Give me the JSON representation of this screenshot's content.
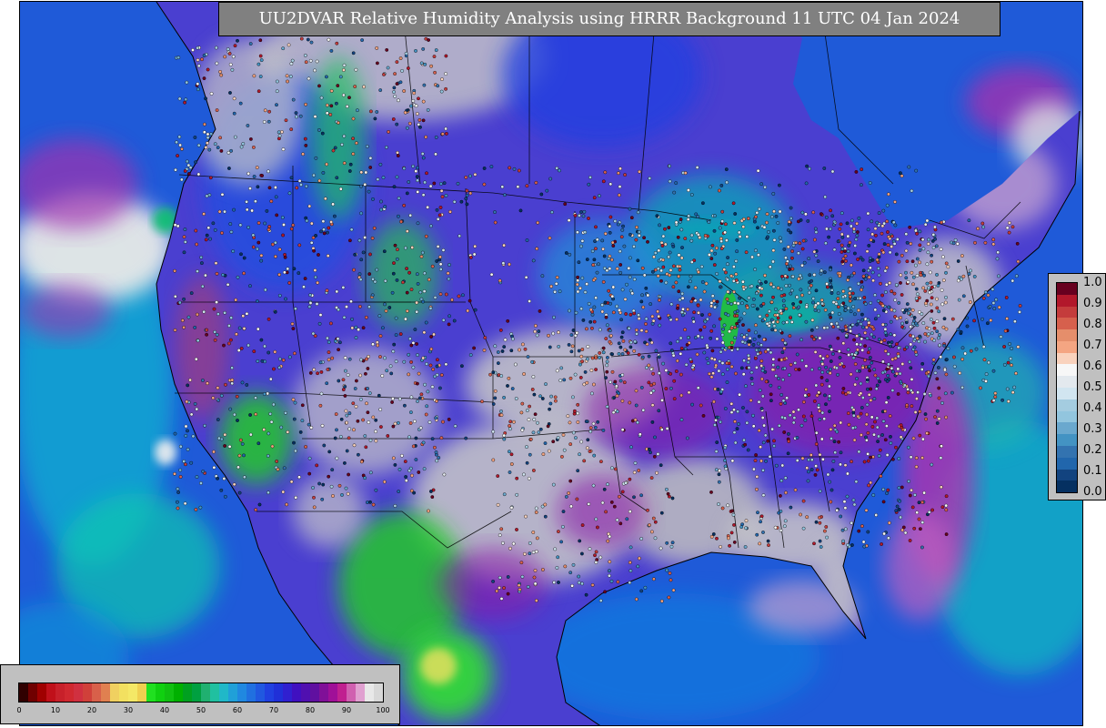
{
  "title": "UU2DVAR Relative Humidity Analysis using HRRR Background 11 UTC 04 Jan 2024",
  "colors": {
    "ocean_base": "#1f5ad8",
    "land_base": "#4a3fd0",
    "dry_gray": "#c8c8c8",
    "humid_purple": "#8a1aa8",
    "green": "#20d020",
    "teal": "#10a8b0",
    "lake_green": "#20c040"
  },
  "obs_scale": {
    "labels": [
      "1.0",
      "0.9",
      "0.8",
      "0.7",
      "0.6",
      "0.5",
      "0.4",
      "0.3",
      "0.2",
      "0.1",
      "0.0"
    ],
    "colors": [
      "#67001f",
      "#b2182b",
      "#c43c3c",
      "#d6604d",
      "#e58e6b",
      "#f4a582",
      "#f9d2bd",
      "#f7f7f7",
      "#e3e9ee",
      "#d1e5f0",
      "#a4cce0",
      "#92c5de",
      "#6aa8ce",
      "#4393c3",
      "#3373b0",
      "#2166ac",
      "#12437f",
      "#053061"
    ]
  },
  "rh_scale": {
    "labels": [
      "0",
      "10",
      "20",
      "30",
      "40",
      "50",
      "60",
      "70",
      "80",
      "90",
      "100"
    ],
    "colors": [
      "#300000",
      "#700000",
      "#a00000",
      "#c0101a",
      "#c8202a",
      "#d02830",
      "#d03040",
      "#d0403a",
      "#d8604a",
      "#e08050",
      "#f0d060",
      "#f2e060",
      "#f4e866",
      "#f0d050",
      "#20e020",
      "#10d010",
      "#10c010",
      "#00b000",
      "#00a020",
      "#00a040",
      "#20b070",
      "#20c0a0",
      "#20b8c8",
      "#20a0d8",
      "#2088e0",
      "#2070e0",
      "#2058e0",
      "#2040e0",
      "#2030d8",
      "#3020d0",
      "#4010c0",
      "#5010b0",
      "#6010a0",
      "#801098",
      "#a01098",
      "#c02090",
      "#d060b0",
      "#e0a0d0",
      "#e8e8e8",
      "#d8d8d8"
    ]
  }
}
